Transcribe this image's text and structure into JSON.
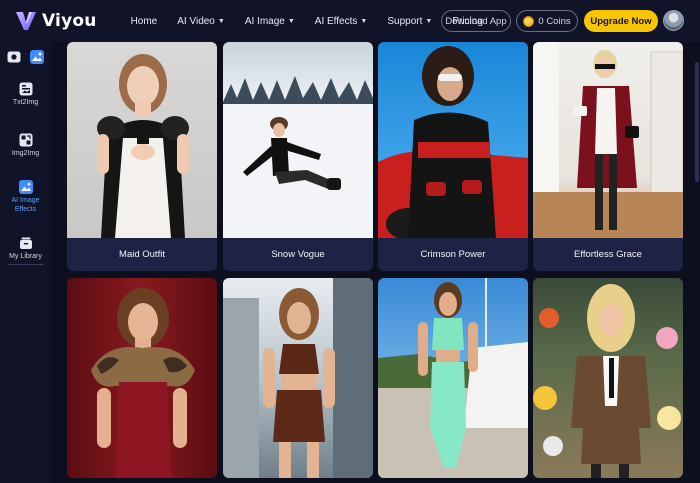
{
  "brand": {
    "name": "Viyou"
  },
  "nav": {
    "home": "Home",
    "ai_video": "AI Video",
    "ai_image": "AI Image",
    "ai_effects": "AI Effects",
    "support": "Support",
    "pricing": "Pricing"
  },
  "header": {
    "download_label": "Download App",
    "coins_label": "0 Coins",
    "upgrade_label": "Upgrade Now"
  },
  "sidebar": {
    "items": [
      {
        "label": "Txt2Img",
        "icon": "text-image-icon"
      },
      {
        "label": "Img2Img",
        "icon": "image-image-icon"
      },
      {
        "label": "AI Image Effects",
        "icon": "ai-effects-icon",
        "active": true
      },
      {
        "label": "My Library",
        "icon": "library-icon"
      }
    ]
  },
  "cards": [
    {
      "title": "Maid Outfit"
    },
    {
      "title": "Snow Vogue"
    },
    {
      "title": "Crimson Power"
    },
    {
      "title": "Effortless Grace"
    },
    {
      "title": ""
    },
    {
      "title": ""
    },
    {
      "title": ""
    },
    {
      "title": ""
    }
  ],
  "colors": {
    "background": "#0d0f1e",
    "panel": "#111328",
    "card_footer": "#1e2244",
    "upgrade": "#f7c600",
    "active": "#5aa0ff"
  }
}
